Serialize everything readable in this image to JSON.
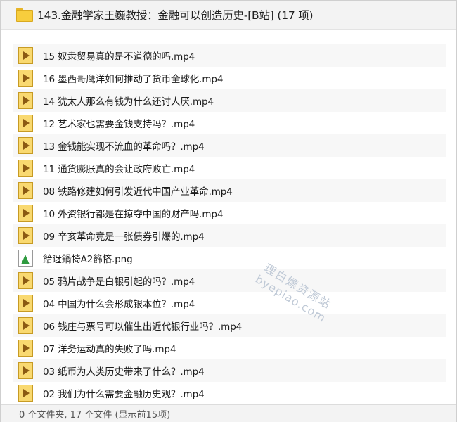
{
  "header": {
    "folder_icon": "folder-icon",
    "title": "143.金融学家王巍教授：金融可以创造历史-[B站] (17 项)"
  },
  "files": [
    {
      "name": "15 奴隶贸易真的是不道德的吗.mp4",
      "icon": "video-file-icon"
    },
    {
      "name": "16 墨西哥鹰洋如何推动了货币全球化.mp4",
      "icon": "video-file-icon"
    },
    {
      "name": "14 犹太人那么有钱为什么还讨人厌.mp4",
      "icon": "video-file-icon"
    },
    {
      "name": "12 艺术家也需要金钱支持吗？.mp4",
      "icon": "video-file-icon"
    },
    {
      "name": "13 金钱能实现不流血的革命吗？.mp4",
      "icon": "video-file-icon"
    },
    {
      "name": "11 通货膨胀真的会让政府败亡.mp4",
      "icon": "video-file-icon"
    },
    {
      "name": "08 铁路修建如何引发近代中国产业革命.mp4",
      "icon": "video-file-icon"
    },
    {
      "name": "10 外资银行都是在掠夺中国的财产吗.mp4",
      "icon": "video-file-icon"
    },
    {
      "name": "09 辛亥革命竟是一张债券引爆的.mp4",
      "icon": "video-file-icon"
    },
    {
      "name": "餄迓鍋犄A2籂悋.png",
      "icon": "image-file-icon"
    },
    {
      "name": "05 鸦片战争是白银引起的吗？.mp4",
      "icon": "video-file-icon"
    },
    {
      "name": "04 中国为什么会形成银本位？.mp4",
      "icon": "video-file-icon"
    },
    {
      "name": "06 钱庄与票号可以催生出近代银行业吗？.mp4",
      "icon": "video-file-icon"
    },
    {
      "name": "07 洋务运动真的失败了吗.mp4",
      "icon": "video-file-icon"
    },
    {
      "name": "03 纸币为人类历史带来了什么？.mp4",
      "icon": "video-file-icon"
    },
    {
      "name": "02 我们为什么需要金融历史观？.mp4",
      "icon": "video-file-icon"
    }
  ],
  "watermark": {
    "line1": "理白嫖资源站",
    "line2": "byepiao.com"
  },
  "status": {
    "text": "0 个文件夹, 17 个文件 (显示前15项)"
  }
}
